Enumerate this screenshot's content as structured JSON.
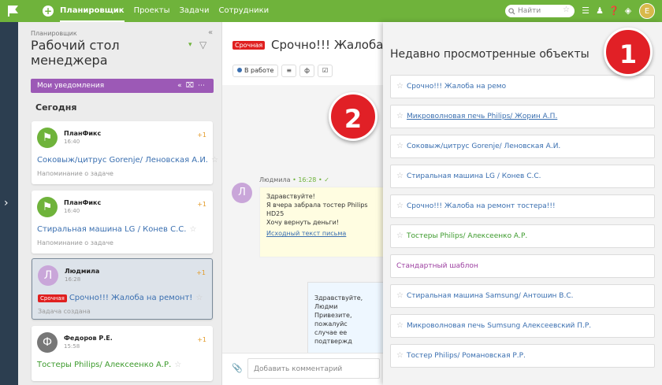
{
  "topbar": {
    "nav": [
      "Планировщик",
      "Проекты",
      "Задачи",
      "Сотрудники"
    ],
    "search_placeholder": "Найти",
    "avatar_letter": "Е"
  },
  "left": {
    "breadcrumb": "Планировщик",
    "title": "Рабочий стол менеджера",
    "notifications_label": "Мои уведомления",
    "section_today": "Сегодня",
    "cards": [
      {
        "sender": "ПланФикс",
        "time": "16:40",
        "count": "+1",
        "task": "Соковыж/цитрус Gorenje/ Леновская А.И.",
        "sub": "Напоминание о задаче",
        "avatar": ""
      },
      {
        "sender": "ПланФикс",
        "time": "16:40",
        "count": "+1",
        "task": "Стиральная машина LG / Конев С.С.",
        "sub": "Напоминание о задаче",
        "avatar": ""
      },
      {
        "sender": "Людмила",
        "time": "16:28",
        "count": "+1",
        "urgent": "Срочная",
        "task": "Срочно!!! Жалоба на ремонт!",
        "sub": "Задача создана",
        "avatar": "Л"
      },
      {
        "sender": "Федоров Р.Е.",
        "time": "15:58",
        "count": "+1",
        "task": "Тостеры Philips/ Алексеенко А.Р.",
        "sub": "",
        "avatar": "Ф"
      }
    ]
  },
  "middle": {
    "urgent": "Срочная",
    "title": "Срочно!!! Жалоба на",
    "status": "В работе",
    "msg_author": "Людмила",
    "msg_time": "• 16:28 • ✓",
    "msg_avatar": "Л",
    "msg_lines": [
      "Здравствуйте!",
      "Я вчера забрала тостер Philips HD25",
      "Хочу вернуть деньги!"
    ],
    "msg_link": "Исходный текст письма",
    "reply_lines": [
      "Здравствуйте, Людми",
      "Привезите, пожалуйс",
      "случае ее подтвержд"
    ],
    "comment_placeholder": "Добавить комментарий"
  },
  "recent": {
    "title": "Недавно просмотренные объекты",
    "items": [
      {
        "text": "Срочно!!! Жалоба на ремо",
        "style": "link"
      },
      {
        "text": "Микроволновая печь Philips/ Жорин А.П.",
        "style": "link underline"
      },
      {
        "text": "Соковыж/цитрус Gorenje/ Леновская А.И.",
        "style": "link"
      },
      {
        "text": "Стиральная машина LG / Конев С.С.",
        "style": "link"
      },
      {
        "text": "Срочно!!! Жалоба на ремонт тостера!!!",
        "style": "link"
      },
      {
        "text": "Тостеры Philips/ Алексеенко А.Р.",
        "style": "green"
      },
      {
        "text": "Стандартный шаблон",
        "style": "purple"
      },
      {
        "text": "Стиральная машина Samsung/ Антошин В.С.",
        "style": "link"
      },
      {
        "text": "Микроволновая печь Sumsung Алексеевский П.Р.",
        "style": "link"
      },
      {
        "text": "Тостер Philips/ Романовская Р.Р.",
        "style": "link"
      }
    ]
  },
  "callouts": [
    "1",
    "2"
  ]
}
